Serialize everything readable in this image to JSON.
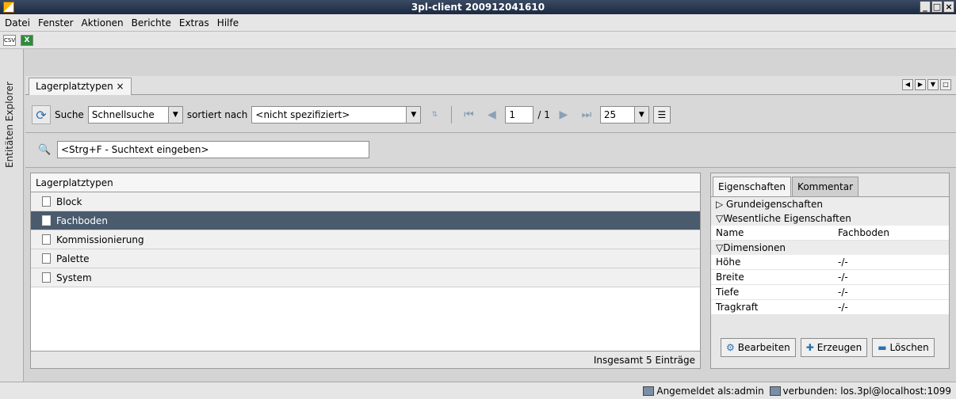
{
  "window": {
    "title": "3pl-client 200912041610"
  },
  "menu": [
    "Datei",
    "Fenster",
    "Aktionen",
    "Berichte",
    "Extras",
    "Hilfe"
  ],
  "toolbar": {
    "csv": "CSV"
  },
  "sidebar": {
    "label": "Entitäten Explorer"
  },
  "tab": {
    "label": "Lagerplatztypen",
    "close": "×"
  },
  "nav": {
    "search_label": "Suche",
    "search_mode": "Schnellsuche",
    "sort_label": "sortiert nach",
    "sort_value": "<nicht spezifiziert>",
    "page": "1",
    "page_total": "/ 1",
    "page_size": "25"
  },
  "search": {
    "placeholder": "<Strg+F - Suchtext eingeben>"
  },
  "list": {
    "header": "Lagerplatztypen",
    "rows": [
      "Block",
      "Fachboden",
      "Kommissionierung",
      "Palette",
      "System"
    ],
    "selected": "Fachboden",
    "footer": "Insgesamt 5 Einträge"
  },
  "props": {
    "tabs": [
      "Eigenschaften",
      "Kommentar"
    ],
    "sections": {
      "basic": "▷ Grundeigenschaften",
      "essential": "▽Wesentliche Eigenschaften",
      "dimensions": "▽Dimensionen"
    },
    "name_key": "Name",
    "name_value": "Fachboden",
    "dim_rows": [
      {
        "k": "Höhe",
        "v": "-/-"
      },
      {
        "k": "Breite",
        "v": "-/-"
      },
      {
        "k": "Tiefe",
        "v": "-/-"
      },
      {
        "k": "Tragkraft",
        "v": "-/-"
      }
    ],
    "buttons": [
      "Bearbeiten",
      "Erzeugen",
      "Löschen"
    ]
  },
  "status": {
    "login": "Angemeldet als:admin",
    "connection": "verbunden: los.3pl@localhost:1099"
  }
}
